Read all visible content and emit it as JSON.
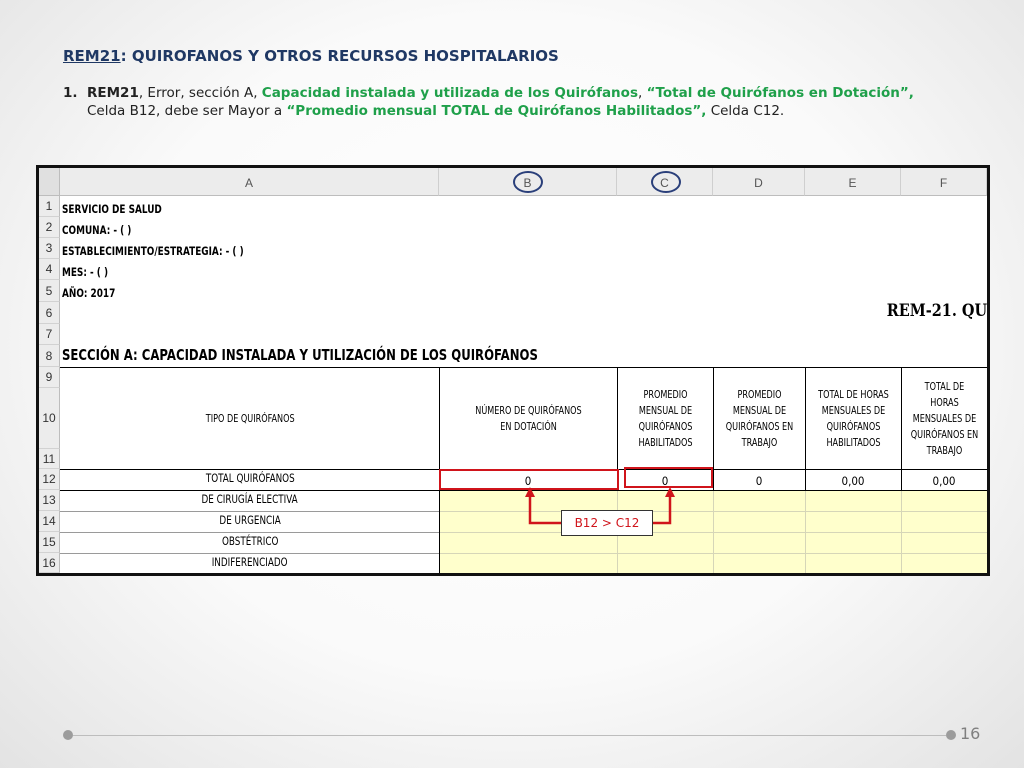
{
  "heading": {
    "code": "REM21",
    "rest": ": QUIROFANOS Y OTROS RECURSOS HOSPITALARIOS"
  },
  "item": {
    "number": "1.",
    "code": "REM21",
    "t1": ", Error, sección A, ",
    "g1": "Capacidad instalada y utilizada de los Quirófanos",
    "t2": ", ",
    "g2": "“Total de Quirófanos en Dotación”,",
    "t3": "Celda B12, debe ser Mayor a ",
    "g3": "“Promedio mensual TOTAL de Quirófanos Habilitados”,",
    "t4": " Celda C12."
  },
  "sheet": {
    "columns": [
      "A",
      "B",
      "C",
      "D",
      "E",
      "F"
    ],
    "rows": [
      "1",
      "2",
      "3",
      "4",
      "5",
      "6",
      "7",
      "8",
      "9",
      "10",
      "11",
      "12",
      "13",
      "14",
      "15",
      "16"
    ],
    "meta": {
      "servicio": "SERVICIO DE SALUD",
      "comuna": "COMUNA:  - (  )",
      "establecimiento": "ESTABLECIMIENTO/ESTRATEGIA:  - (  )",
      "mes": "MES:  - (  )",
      "anio": "AÑO: 2017"
    },
    "rem_title": "REM-21.  QU",
    "section_title": "SECCIÓN A:  CAPACIDAD INSTALADA Y UTILIZACIÓN DE LOS QUIRÓFANOS",
    "headers": {
      "tipo": "TIPO DE QUIRÓFANOS",
      "b": "NÚMERO DE QUIRÓFANOS EN DOTACIÓN",
      "c": "PROMEDIO MENSUAL DE QUIRÓFANOS HABILITADOS",
      "d": "PROMEDIO MENSUAL  DE QUIRÓFANOS EN TRABAJO",
      "e": "TOTAL  DE HORAS MENSUALES DE QUIRÓFANOS HABILITADOS",
      "f": "TOTAL DE HORAS MENSUALES DE QUIRÓFANOS EN TRABAJO"
    },
    "row_labels": [
      "TOTAL QUIRÓFANOS",
      "DE CIRUGÍA ELECTIVA",
      "DE URGENCIA",
      "OBSTÉTRICO",
      "INDIFERENCIADO"
    ],
    "total_values": [
      "0",
      "0",
      "0",
      "0,00",
      "0,00"
    ]
  },
  "callout": "B12 > C12",
  "page_number": "16",
  "colors": {
    "heading": "#1F3864",
    "highlight_green": "#1FA04A",
    "error_red": "#D0141B",
    "input_yellow": "#FFFFCC",
    "circle_blue": "#2A3F7A"
  }
}
